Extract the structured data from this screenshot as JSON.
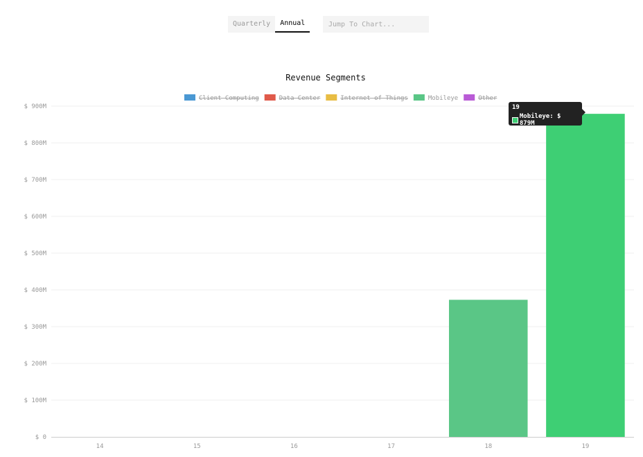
{
  "controls": {
    "period_options": [
      "Quarterly",
      "Annual"
    ],
    "selected_period": "Annual",
    "jump_placeholder": "Jump To Chart..."
  },
  "tooltip": {
    "title": "19",
    "label": "Mobileye: $ 879M",
    "color": "#3ecf74"
  },
  "chart_data": {
    "type": "bar",
    "title": "Revenue Segments",
    "xlabel": "",
    "ylabel": "",
    "categories": [
      "14",
      "15",
      "16",
      "17",
      "18",
      "19"
    ],
    "series": [
      {
        "name": "Client Computing",
        "color": "#4a98d3",
        "hidden": true,
        "values": [
          null,
          null,
          null,
          null,
          null,
          null
        ]
      },
      {
        "name": "Data Center",
        "color": "#e05a4a",
        "hidden": true,
        "values": [
          null,
          null,
          null,
          null,
          null,
          null
        ]
      },
      {
        "name": "Internet of Things",
        "color": "#e8bd44",
        "hidden": true,
        "values": [
          null,
          null,
          null,
          null,
          null,
          null
        ]
      },
      {
        "name": "Mobileye",
        "color": "#5ac686",
        "hidden": false,
        "values": [
          null,
          null,
          null,
          null,
          373,
          879
        ]
      },
      {
        "name": "Other",
        "color": "#b95bd6",
        "hidden": true,
        "values": [
          null,
          null,
          null,
          null,
          null,
          null
        ]
      }
    ],
    "highlighted_category": "19",
    "highlight_color": "#3ecf74",
    "ylim": [
      0,
      900
    ],
    "yticks": [
      0,
      100,
      200,
      300,
      400,
      500,
      600,
      700,
      800,
      900
    ],
    "ytick_labels": [
      "$ 0",
      "$ 100M",
      "$ 200M",
      "$ 300M",
      "$ 400M",
      "$ 500M",
      "$ 600M",
      "$ 700M",
      "$ 800M",
      "$ 900M"
    ],
    "grid": true,
    "legend_position": "top-center"
  }
}
